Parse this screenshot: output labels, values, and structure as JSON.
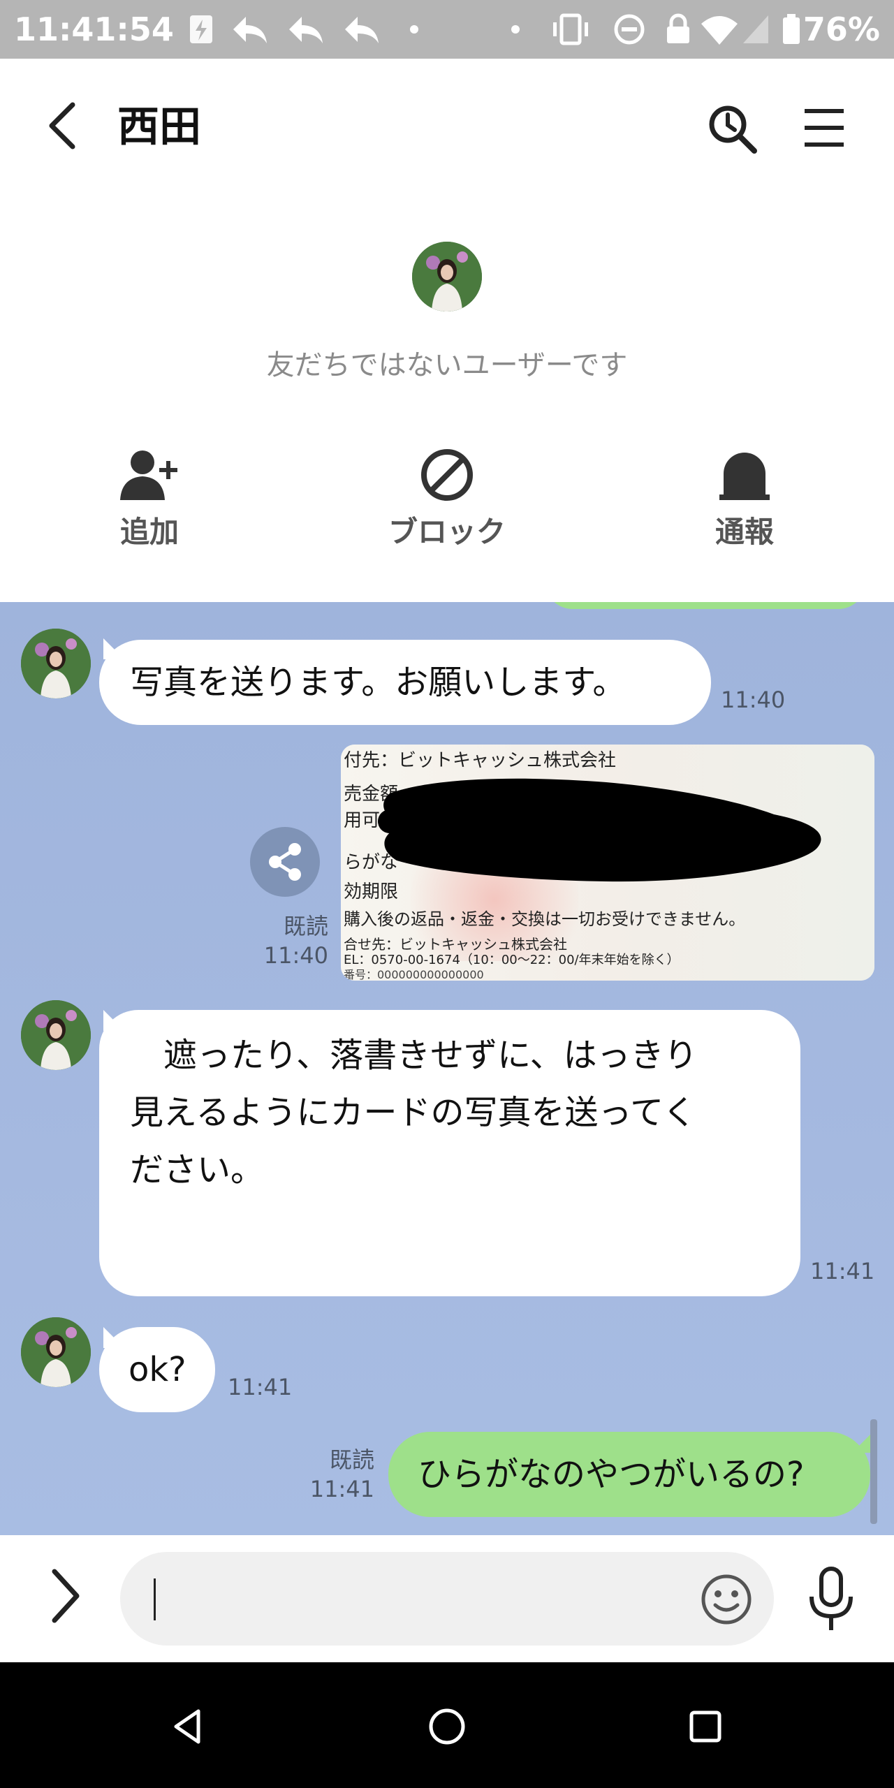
{
  "status_bar": {
    "time": "11:41:54",
    "battery": "76%"
  },
  "header": {
    "title": "西田"
  },
  "profile": {
    "notice": "友だちではないユーザーです",
    "actions": [
      {
        "label": "追加",
        "icon": "add-friend-icon"
      },
      {
        "label": "ブロック",
        "icon": "block-icon"
      },
      {
        "label": "通報",
        "icon": "report-icon"
      }
    ]
  },
  "messages": [
    {
      "side": "left",
      "text": "写真を送ります。お願いします。",
      "time": "11:40"
    },
    {
      "side": "right",
      "type": "image",
      "read": "既読",
      "time": "11:40",
      "image_text": {
        "line1": "付先：ビットキャッシュ株式会社",
        "line2": "売金額",
        "line3": "用可",
        "line4": "らがな",
        "line5": "効期限",
        "line6": "購入後の返品・返金・交換は一切お受けできません。",
        "line7": "合せ先：ビットキャッシュ株式会社",
        "line8": "EL：0570-00-1674（10：00〜22：00/年末年始を除く）",
        "line9": "番号：000000000000000"
      }
    },
    {
      "side": "left",
      "text_lines": [
        "　遮ったり、落書きせずに、はっきり",
        "見えるようにカードの写真を送ってく",
        "ださい。"
      ],
      "time": "11:41"
    },
    {
      "side": "left",
      "text": "ok?",
      "time": "11:41"
    },
    {
      "side": "right",
      "text": "ひらがなのやつがいるの?",
      "read": "既読",
      "time": "11:41"
    }
  ],
  "colors": {
    "chat_bg": "#a2b7de",
    "green_bubble": "#9ee08a",
    "status_bar": "#b5b5b5"
  }
}
